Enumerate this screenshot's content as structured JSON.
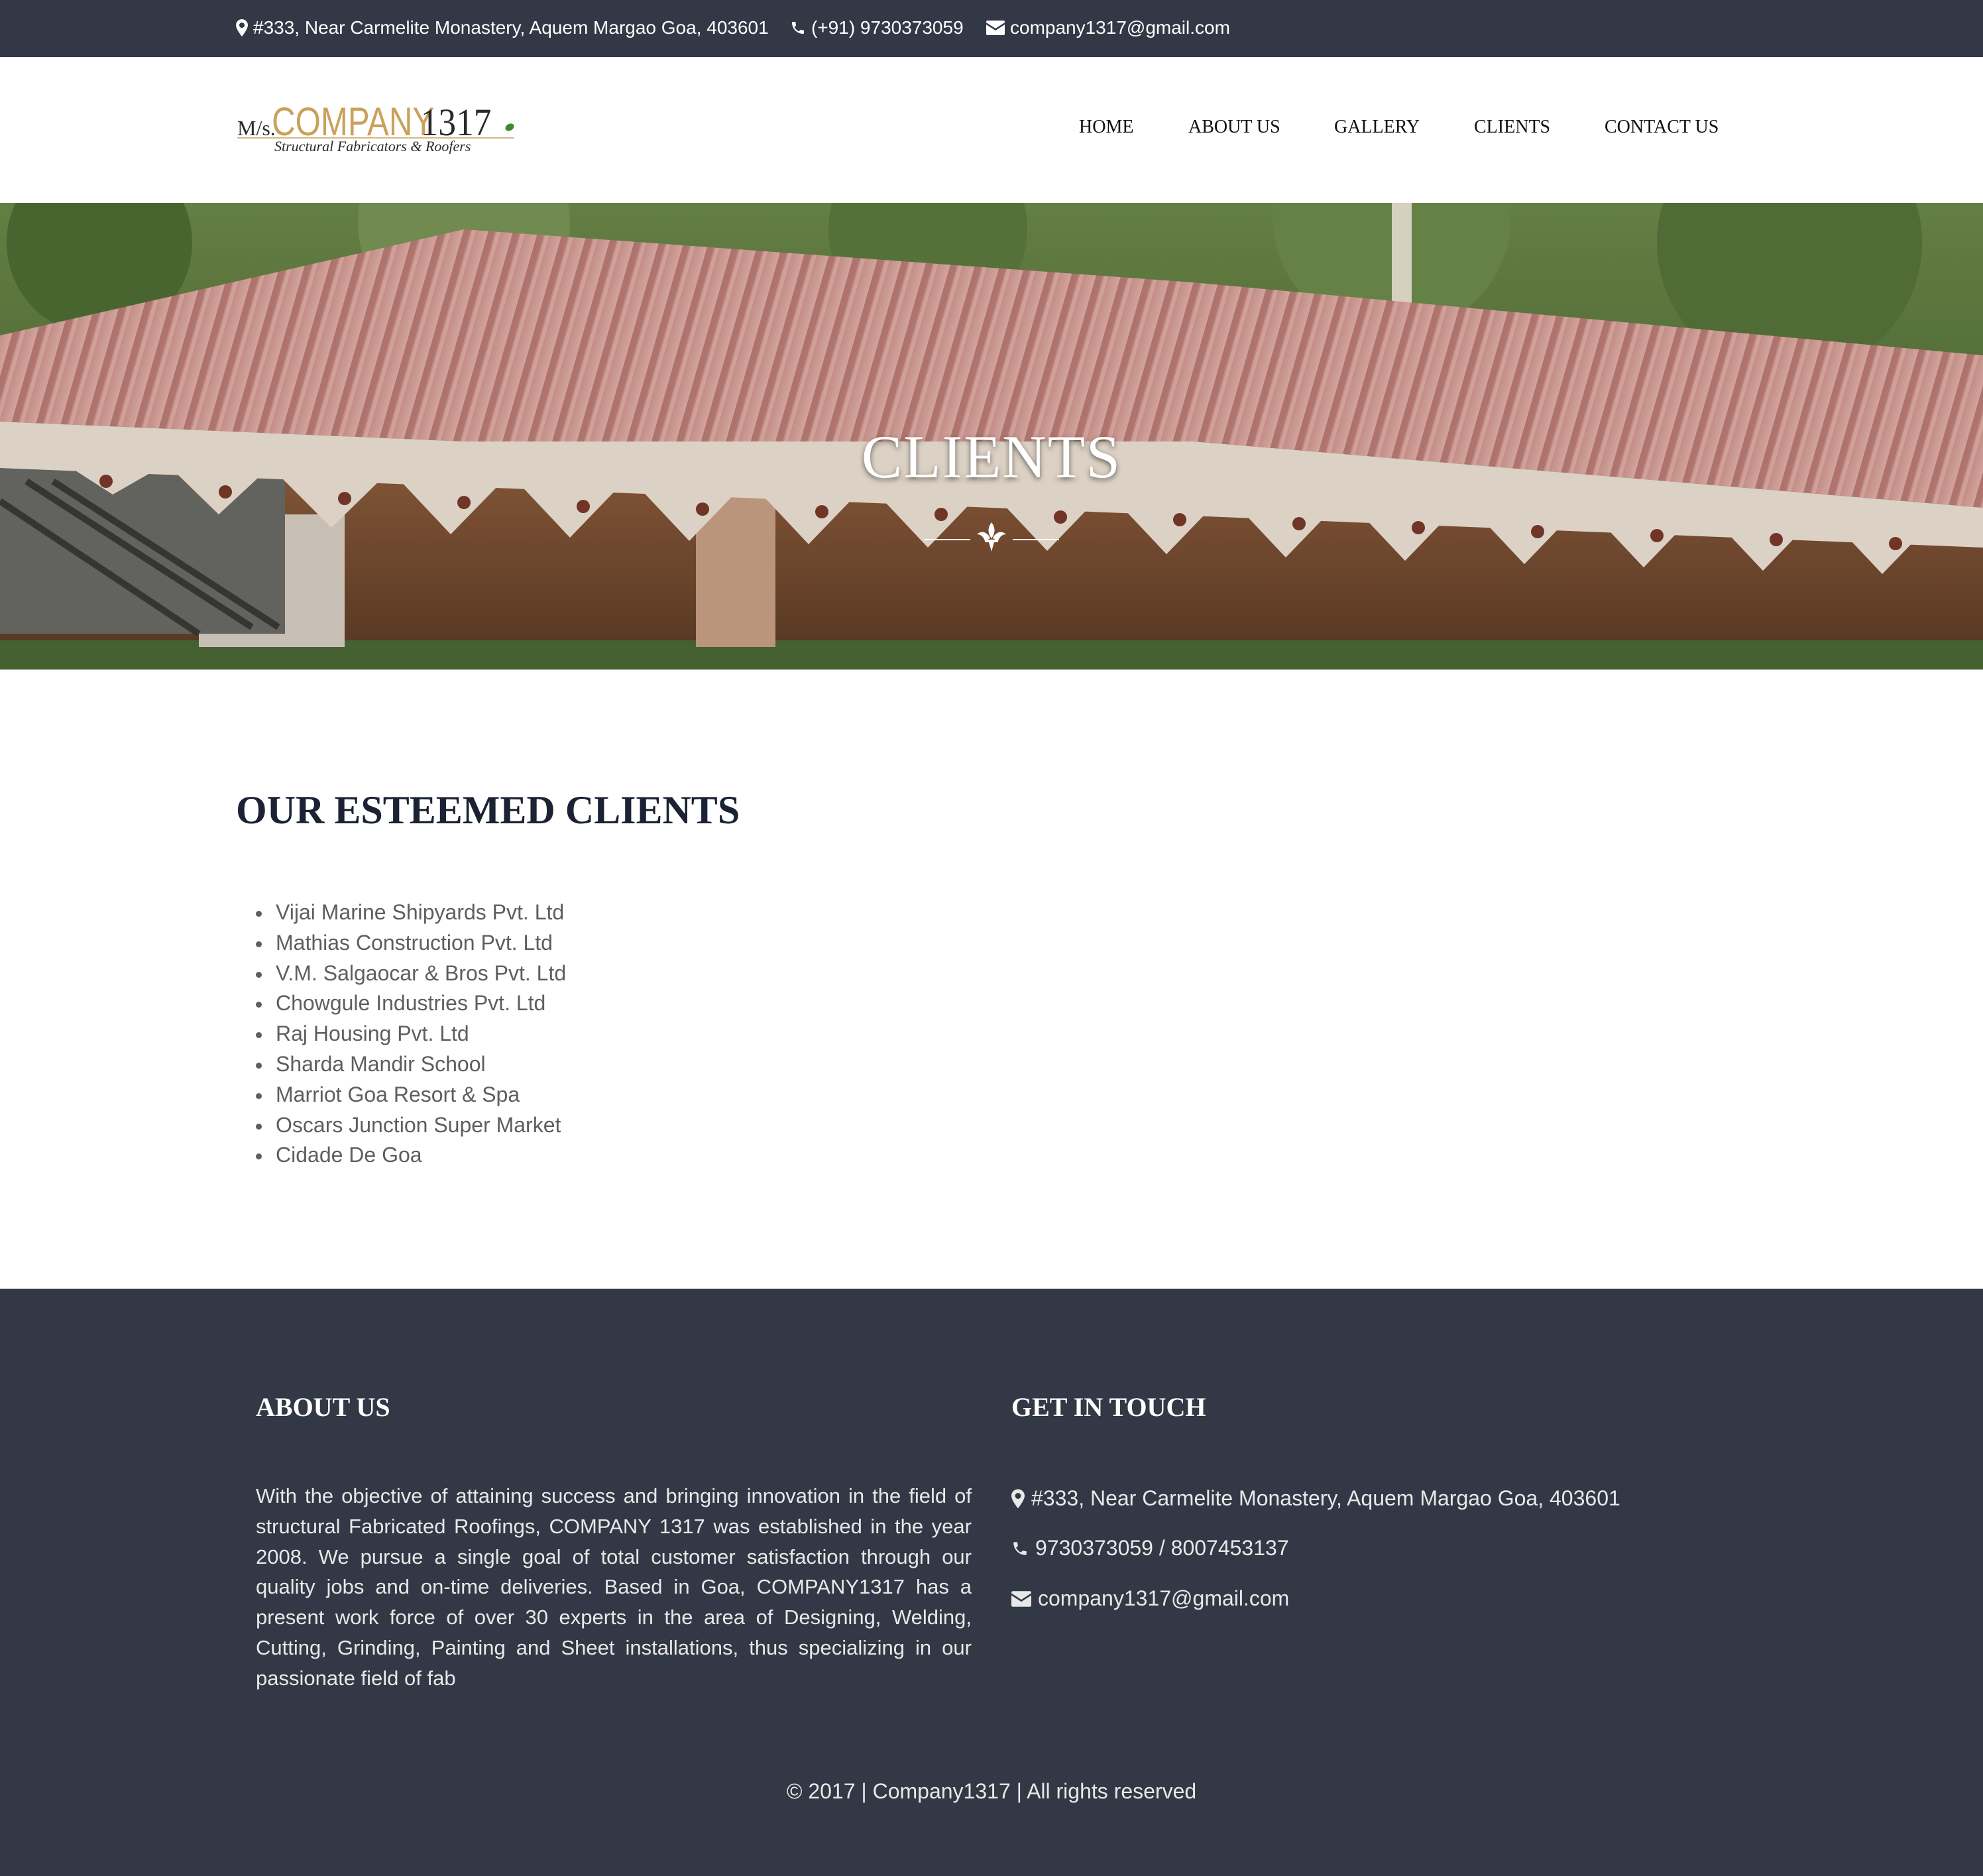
{
  "topbar": {
    "address": "#333, Near Carmelite Monastery, Aquem Margao Goa, 403601",
    "phone": "(+91) 9730373059",
    "email": "company1317@gmail.com",
    "icons": [
      "map-marker-icon",
      "phone-icon",
      "envelope-icon"
    ]
  },
  "header": {
    "logo": {
      "prefix": "M/s.",
      "name": "COMPANY",
      "number": "1317",
      "tagline": "Structural Fabricators & Roofers"
    },
    "nav": [
      "HOME",
      "ABOUT US",
      "GALLERY",
      "CLIENTS",
      "CONTACT US"
    ]
  },
  "hero": {
    "title": "CLIENTS",
    "divider_icon": "fleur-de-lis-icon"
  },
  "main": {
    "title": "OUR ESTEEMED CLIENTS",
    "clients": [
      "Vijai Marine Shipyards Pvt. Ltd",
      "Mathias Construction Pvt. Ltd",
      "V.M. Salgaocar & Bros Pvt. Ltd",
      "Chowgule Industries Pvt. Ltd",
      "Raj Housing Pvt. Ltd",
      "Sharda Mandir School",
      "Marriot Goa Resort & Spa",
      "Oscars Junction Super Market",
      "Cidade De Goa"
    ]
  },
  "footer": {
    "about": {
      "heading": "ABOUT US",
      "text": "With the objective of attaining success and bringing innovation in the field of structural Fabricated Roofings, COMPANY 1317 was established in the year 2008. We pursue a single goal of total customer satisfaction through our quality jobs and on-time deliveries. Based in Goa, COMPANY1317 has a present work force of over 30 experts in the area of Designing, Welding, Cutting, Grinding, Painting and Sheet installations, thus specializing in our passionate field of fab"
    },
    "contact": {
      "heading": "GET IN TOUCH",
      "address": "#333, Near Carmelite Monastery, Aquem Margao Goa, 403601",
      "phone": "9730373059 / 8007453137",
      "email": "company1317@gmail.com"
    },
    "copyright": "© 2017 | Company1317 | All rights reserved"
  },
  "colors": {
    "dark_bar": "#323845",
    "logo_gold": "#c9a15a",
    "logo_dark": "#2a2a2a",
    "heading_dark": "#1a2233",
    "body_gray": "#5e5e5e"
  }
}
